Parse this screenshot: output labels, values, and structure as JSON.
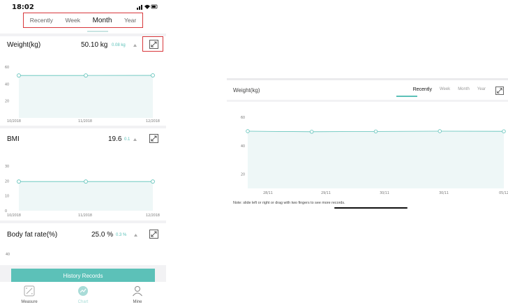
{
  "status_bar": {
    "time": "18:02"
  },
  "period_tabs": [
    "Recently",
    "Week",
    "Month",
    "Year"
  ],
  "active_period": "Month",
  "metrics": {
    "weight": {
      "name": "Weight(kg)",
      "value": "50.10 kg",
      "delta": "0.08 kg",
      "y_ticks": [
        "60",
        "40",
        "20"
      ],
      "x_labels": [
        "10/2018",
        "11/2018",
        "12/2018"
      ]
    },
    "bmi": {
      "name": "BMI",
      "value": "19.6",
      "delta": "0.1",
      "y_ticks": [
        "30",
        "20",
        "10",
        "0"
      ],
      "x_labels": [
        "10/2018",
        "11/2018",
        "12/2018"
      ]
    },
    "body_fat": {
      "name": "Body fat rate(%)",
      "value": "25.0 %",
      "delta": "0.3 %",
      "y_ticks": [
        "40"
      ]
    }
  },
  "history_button": "History Records",
  "bottom_nav": [
    {
      "label": "Measure",
      "icon": "measure-icon"
    },
    {
      "label": "Chart",
      "icon": "chart-icon",
      "active": true
    },
    {
      "label": "Mine",
      "icon": "person-icon"
    }
  ],
  "landscape": {
    "title": "Weight(kg)",
    "tabs": [
      "Recently",
      "Week",
      "Month",
      "Year"
    ],
    "active_tab": "Recently",
    "note": "Note: slide left or right or drag with two fingers to see more records."
  },
  "colors": {
    "accent": "#5cc1b8",
    "area_fill": "#eef7f7",
    "highlight_box": "#d8373b"
  },
  "chart_data": [
    {
      "type": "area",
      "title": "Weight(kg)",
      "categories": [
        "10/2018",
        "11/2018",
        "12/2018"
      ],
      "values": [
        50.0,
        50.0,
        50.1
      ],
      "ylim": [
        0,
        60
      ],
      "y_ticks": [
        20,
        40,
        60
      ],
      "grid": false
    },
    {
      "type": "area",
      "title": "BMI",
      "categories": [
        "10/2018",
        "11/2018",
        "12/2018"
      ],
      "values": [
        19.6,
        19.6,
        19.6
      ],
      "ylim": [
        0,
        30
      ],
      "y_ticks": [
        0,
        10,
        20,
        30
      ],
      "grid": false
    },
    {
      "type": "area",
      "title": "Weight(kg)",
      "categories": [
        "28/11",
        "29/11",
        "30/11",
        "30/11",
        "05/12"
      ],
      "values": [
        50.2,
        49.8,
        50.0,
        50.2,
        50.1
      ],
      "ylim": [
        10,
        60
      ],
      "y_ticks": [
        20,
        40,
        60
      ],
      "grid": false
    }
  ]
}
